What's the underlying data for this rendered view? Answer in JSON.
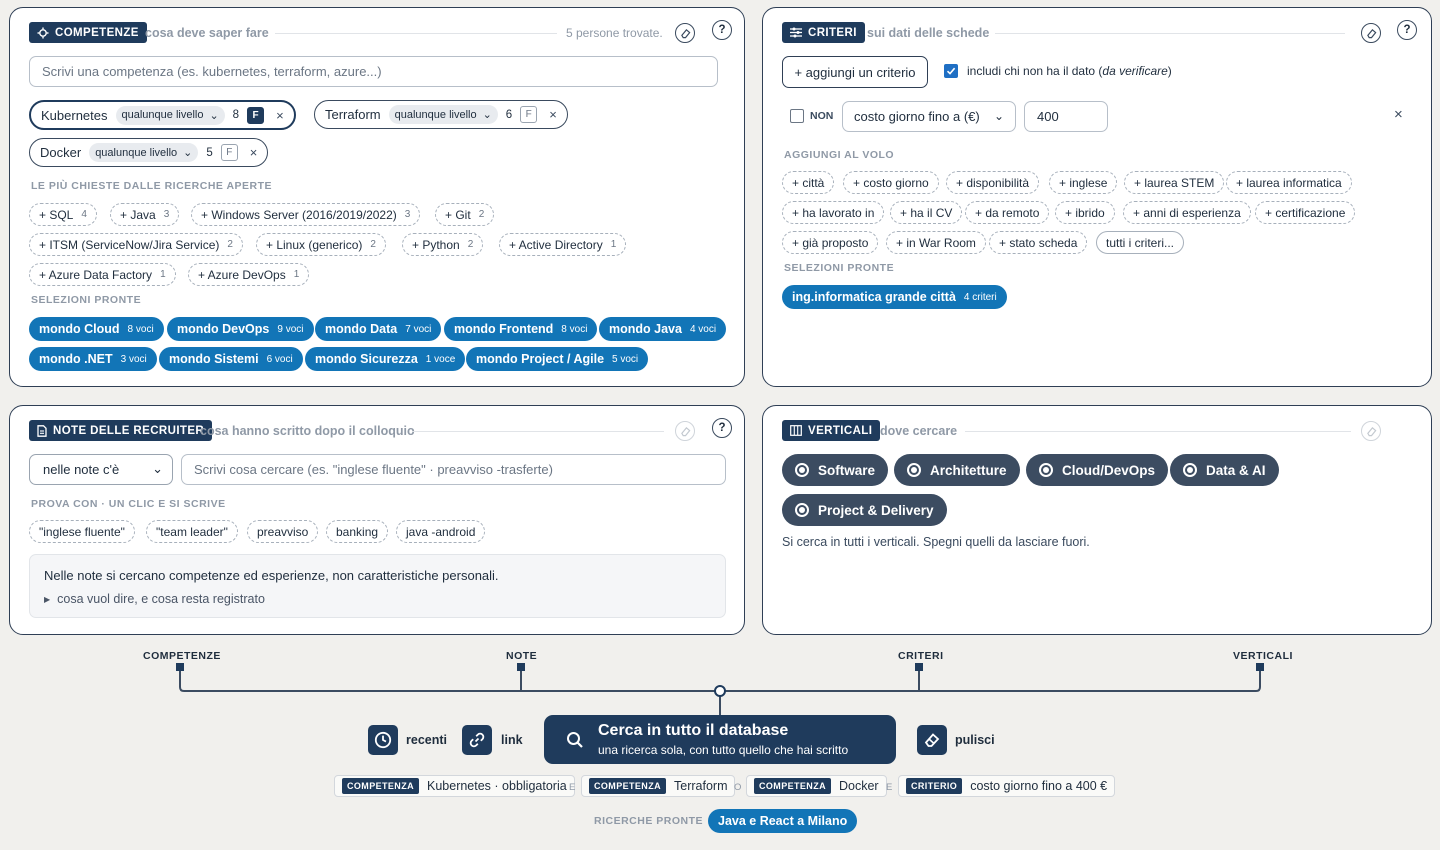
{
  "competenze": {
    "tag": "COMPETENZE",
    "subtitle": "cosa deve saper fare",
    "found": "5 persone trovate.",
    "help": "?",
    "search_placeholder": "Scrivi una competenza (es. kubernetes, terraform, azure...)",
    "selected": [
      {
        "name": "Kubernetes",
        "level": "qualunque livello",
        "count": "8",
        "f": "F",
        "remove": "×"
      },
      {
        "name": "Terraform",
        "level": "qualunque livello",
        "count": "6",
        "f": "F",
        "remove": "×"
      },
      {
        "name": "Docker",
        "level": "qualunque livello",
        "count": "5",
        "f": "F",
        "remove": "×"
      }
    ],
    "popular_title": "LE PIÙ CHIESTE DALLE RICERCHE APERTE",
    "popular": [
      {
        "label": "+ SQL",
        "count": "4"
      },
      {
        "label": "+ Java",
        "count": "3"
      },
      {
        "label": "+ Windows Server (2016/2019/2022)",
        "count": "3"
      },
      {
        "label": "+ Git",
        "count": "2"
      },
      {
        "label": "+ ITSM (ServiceNow/Jira Service)",
        "count": "2"
      },
      {
        "label": "+ Linux (generico)",
        "count": "2"
      },
      {
        "label": "+ Python",
        "count": "2"
      },
      {
        "label": "+ Active Directory",
        "count": "1"
      },
      {
        "label": "+ Azure Data Factory",
        "count": "1"
      },
      {
        "label": "+ Azure DevOps",
        "count": "1"
      }
    ],
    "presets_title": "SELEZIONI PRONTE",
    "presets": [
      {
        "label": "mondo Cloud",
        "count": "8 voci"
      },
      {
        "label": "mondo DevOps",
        "count": "9 voci"
      },
      {
        "label": "mondo Data",
        "count": "7 voci"
      },
      {
        "label": "mondo Frontend",
        "count": "8 voci"
      },
      {
        "label": "mondo Java",
        "count": "4 voci"
      },
      {
        "label": "mondo .NET",
        "count": "3 voci"
      },
      {
        "label": "mondo Sistemi",
        "count": "6 voci"
      },
      {
        "label": "mondo Sicurezza",
        "count": "1 voce"
      },
      {
        "label": "mondo Project / Agile",
        "count": "5 voci"
      }
    ]
  },
  "criteri": {
    "tag": "CRITERI",
    "subtitle": "sui dati delle schede",
    "help": "?",
    "add_button": "+ aggiungi un criterio",
    "include_text": "includi chi non ha il dato (",
    "include_em": "da verificare",
    "include_end": ")",
    "not_label": "NON",
    "criterion": "costo giorno fino a (€)",
    "value": "400",
    "remove": "×",
    "quick_title": "AGGIUNGI AL VOLO",
    "quick": [
      "+ città",
      "+ costo giorno",
      "+ disponibilità",
      "+ inglese",
      "+ laurea STEM",
      "+ laurea informatica",
      "+ ha lavorato in",
      "+ ha il CV",
      "+ da remoto",
      "+ ibrido",
      "+ anni di esperienza",
      "+ certificazione",
      "+ già proposto",
      "+ in War Room",
      "+ stato scheda",
      "tutti i criteri..."
    ],
    "presets_title": "SELEZIONI PRONTE",
    "preset": {
      "label": "ing.informatica grande città",
      "count": "4 criteri"
    }
  },
  "note": {
    "tag": "NOTE DELLE RECRUITER",
    "subtitle": "cosa hanno scritto dopo il colloquio",
    "help": "?",
    "mode": "nelle note c'è",
    "search_placeholder": "Scrivi cosa cercare (es. \"inglese fluente\" · preavviso -trasferte)",
    "try_title": "PROVA CON · UN CLIC E SI SCRIVE",
    "try": [
      "\"inglese fluente\"",
      "\"team leader\"",
      "preavviso",
      "banking",
      "java -android"
    ],
    "info_text": "Nelle note si cercano competenze ed esperienze, non caratteristiche personali.",
    "info_more": "cosa vuol dire, e cosa resta registrato"
  },
  "verticali": {
    "tag": "VERTICALI",
    "subtitle": "dove cercare",
    "items": [
      "Software",
      "Architetture",
      "Cloud/DevOps",
      "Data & AI",
      "Project & Delivery"
    ],
    "note": "Si cerca in tutti i verticali. Spegni quelli da lasciare fuori."
  },
  "flow": {
    "labels": [
      "COMPETENZE",
      "NOTE",
      "CRITERI",
      "VERTICALI"
    ]
  },
  "actions": {
    "recenti": "recenti",
    "link": "link",
    "search_title": "Cerca in tutto il database",
    "search_sub": "una ricerca sola, con tutto quello che hai scritto",
    "pulisci": "pulisci"
  },
  "summary": [
    {
      "type": "COMPETENZA",
      "text": "Kubernetes · obbligatoria"
    },
    {
      "type": "COMPETENZA",
      "text": "Terraform"
    },
    {
      "type": "COMPETENZA",
      "text": "Docker"
    },
    {
      "type": "CRITERIO",
      "text": "costo giorno fino a 400 €"
    }
  ],
  "conj": [
    "E",
    "O",
    "E"
  ],
  "recent": {
    "title": "RICERCHE PRONTE",
    "item": "Java e React a Milano"
  }
}
